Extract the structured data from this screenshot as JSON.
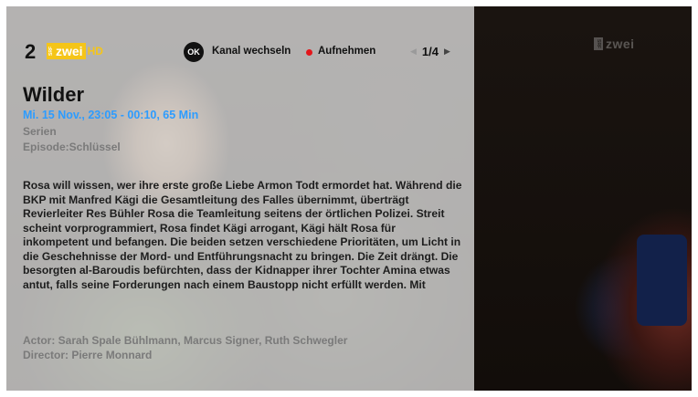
{
  "channel": {
    "number": "2",
    "logo_srf": "SRF",
    "logo_name": "zwei",
    "logo_hd": "HD"
  },
  "actions": {
    "ok_key": "OK",
    "ok_label": "Kanal wechseln",
    "record_label": "Aufnehmen",
    "record_color": "#e3161b"
  },
  "pager": {
    "text": "1/4"
  },
  "program": {
    "title": "Wilder",
    "time": "Mi. 15 Nov., 23:05 - 00:10, 65 Min",
    "genre": "Serien",
    "episode": "Episode:Schlüssel",
    "description": "Rosa will wissen, wer ihre erste große Liebe Armon Todt ermordet hat. Während die BKP mit Manfred Kägi die Gesamtleitung des Falles übernimmt, überträgt Revierleiter Res Bühler Rosa die Teamleitung seitens der örtlichen Polizei. Streit scheint vorprogrammiert, Rosa findet Kägi arrogant, Kägi hält Rosa für inkompetent und befangen. Die beiden setzen verschiedene Prioritäten, um Licht in die Geschehnisse der Mord- und Entführungsnacht zu bringen. Die Zeit drängt. Die besorgten al-Baroudis befürchten, dass der Kidnapper ihrer Tochter Amina etwas antut, falls seine Forderungen nach einem Baustopp nicht erfüllt werden. Mit",
    "actors": "Actor: Sarah Spale Bühlmann, Marcus Signer, Ruth Schwegler",
    "director": "Director: Pierre Monnard"
  },
  "video_watermark": {
    "srf": "SRF",
    "name": "zwei"
  },
  "colors": {
    "accent_time": "#2d9cff",
    "brand_yellow": "#f5c518",
    "overlay": "#d6d6d6"
  }
}
